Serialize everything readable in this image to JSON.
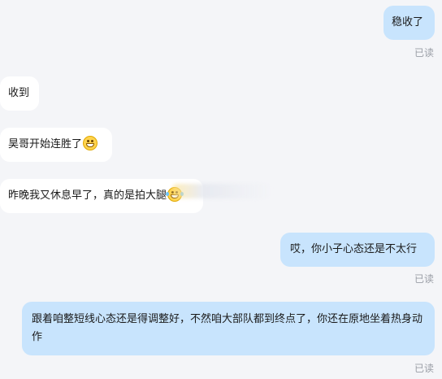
{
  "messages": [
    {
      "text": "稳收了",
      "read": "已读"
    },
    {
      "text": "收到"
    },
    {
      "text": "昊哥开始连胜了",
      "emoji": "grin-emoji-icon"
    },
    {
      "text": "昨晚我又休息早了，真的是拍大腿",
      "emoji": "laughing-tears-emoji-icon"
    },
    {
      "text": "哎，你小子心态还是不太行",
      "read": "已读"
    },
    {
      "text": "跟着咱整短线心态还是得调整好，不然咱大部队都到终点了，你还在原地坐着热身动作",
      "read": "已读"
    }
  ],
  "colors": {
    "outgoing_bubble": "#c8e4fd",
    "incoming_bubble": "#ffffff",
    "background": "#f4f5f8",
    "read_status": "#9a9ea6"
  }
}
